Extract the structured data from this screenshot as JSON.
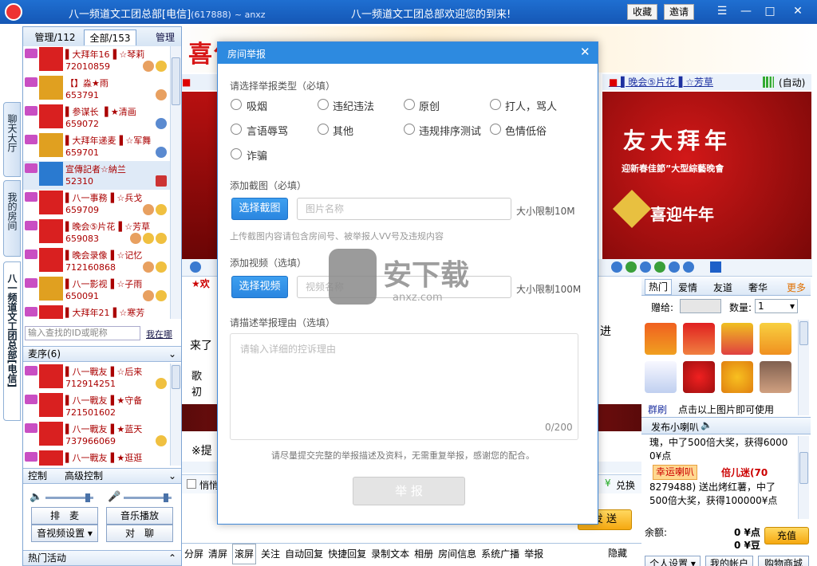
{
  "titlebar": {
    "title": "八一频道文工团总部[电信]",
    "room_id": "(617888)",
    "site": "~ anxz",
    "welcome": "八一频道文工团总部欢迎您的到来!",
    "favorite": "收藏",
    "invite": "邀请"
  },
  "side_tabs": [
    "聊天大厅",
    "我的房间",
    "八一频道文工团总部[电信]"
  ],
  "left": {
    "tab_manage": "管理/112",
    "tab_all": "全部/153",
    "manage_link": "管理",
    "users": [
      {
        "name": "▌大拜年16▐ ☆琴莉",
        "id": "72010859"
      },
      {
        "name": "【】淼★雨",
        "id": "653791"
      },
      {
        "name": "▌参谋长 ▐ ★清画",
        "id": "659072"
      },
      {
        "name": "▌大拜年递麦▐ ☆军舞",
        "id": "659701"
      },
      {
        "name": "宣傳記者☆納兰",
        "id": "52310"
      },
      {
        "name": "▌八一事務▐ ☆兵戈",
        "id": "659709"
      },
      {
        "name": "▌晚会⑤片花▐ ☆芳草",
        "id": "659083"
      },
      {
        "name": "▌晚会录像▐ ☆记忆",
        "id": "712160868"
      },
      {
        "name": "▌八一影视▐ ☆子雨",
        "id": "650091"
      },
      {
        "name": "▌大拜年21▐ ☆寒芳",
        "id": ""
      }
    ],
    "search_placeholder": "输入查找的ID或昵称",
    "where_am_i": "我在哪",
    "mic_queue": "麦序(6)",
    "mic_users": [
      {
        "name": "▌八一戰友▐ ☆后来",
        "id": "712914251"
      },
      {
        "name": "▌八一戰友▐ ★守备",
        "id": "721501602"
      },
      {
        "name": "▌八一戰友▐ ★蓝天",
        "id": "737966069"
      },
      {
        "name": "▌八一戰友▐ ★逛逛",
        "id": ""
      }
    ],
    "control": "控制",
    "advanced_control": "高级控制",
    "btn_queue": "排　麦",
    "btn_music": "音乐播放",
    "btn_av": "音视频设置",
    "btn_chat": "对　聊",
    "hot": "热门活动"
  },
  "stage": {
    "banner_text": "喜气洋",
    "video2_title": "▌晚会⑤片花▐ ☆芳草",
    "auto": "(自动)",
    "video2_text1": "友大拜年",
    "video2_text2": "迎新春佳節”大型綜藝晚會",
    "video2_text3": "喜迎牛年",
    "chat_text1": "★欢",
    "chat_text2": "来了",
    "chat_text3": "进",
    "chat_text4": "歌",
    "chat_text5": "初",
    "chat_text6": "※提",
    "check_label": "悄悄",
    "exchange": "兑换",
    "send": "发 送"
  },
  "right": {
    "tabs": [
      "热门",
      "爱情",
      "友道",
      "奢华"
    ],
    "more": "更多",
    "gift_to": "赠给:",
    "qty_label": "数量:",
    "qty_value": "1",
    "group": "群刷",
    "click_hint": "点击以上图片即可使用",
    "horn": "发布小喇叭",
    "horn_msg1": "瑰，中了500倍大奖，获得6000",
    "horn_msg2": "0¥点",
    "lucky": "幸运喇叭",
    "fan": "倍儿迷(70",
    "horn_msg3": "8279488) 送出烤红薯，中了",
    "horn_msg4": "500倍大奖，获得100000¥点",
    "balance": "余额:",
    "bal_point": "0 ¥点",
    "bal_bean": "0 ¥豆",
    "recharge": "充值",
    "personal": "个人设置",
    "account": "我的帐户",
    "mall": "购物商城"
  },
  "toolbar": [
    "分屏",
    "清屏",
    "滚屏",
    "关注",
    "自动回复",
    "快捷回复",
    "录制文本",
    "相册",
    "房间信息",
    "系统广播",
    "举报"
  ],
  "hide": "隐藏",
  "dialog": {
    "title": "房间举报",
    "type_label": "请选择举报类型（必填）",
    "types": [
      "吸烟",
      "违纪违法",
      "原创",
      "打人，骂人",
      "言语辱骂",
      "其他",
      "违规排序测试",
      "色情低俗",
      "诈骗"
    ],
    "screenshot_label": "添加截图（必填）",
    "select_screenshot": "选择截图",
    "image_name": "图片名称",
    "size_10m": "大小限制10M",
    "screenshot_hint": "上传截图内容请包含房间号、被举报人VV号及违规内容",
    "video_label": "添加视频（选填）",
    "select_video": "选择视频",
    "video_name": "视频名称",
    "size_100m": "大小限制100M",
    "reason_label": "请描述举报理由（选填）",
    "reason_placeholder": "请输入详细的控诉理由",
    "counter": "0/200",
    "notice": "请尽量提交完整的举报描述及资料，无需重复举报，感谢您的配合。",
    "submit": "举 报"
  },
  "watermark": {
    "text": "安下载",
    "sub": "anxz.com"
  },
  "colors": {
    "title_blue": "#1f6fd1",
    "dialog_blue": "#2d8ae0",
    "name_red": "#aa0000"
  }
}
